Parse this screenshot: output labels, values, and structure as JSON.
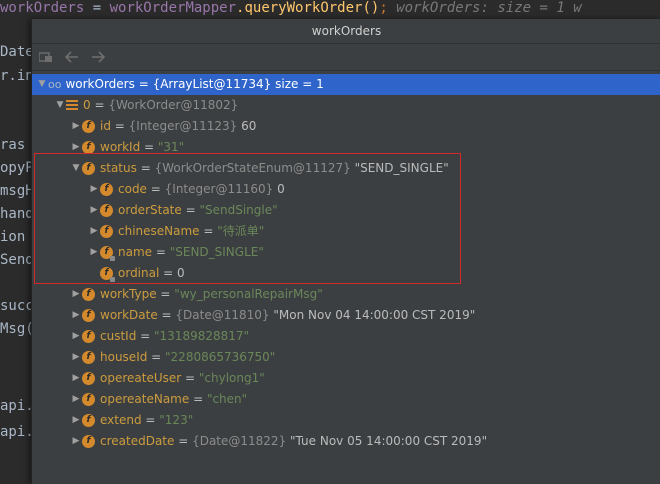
{
  "code_line": {
    "var": "workOrders",
    "assign": " = ",
    "receiver": "workOrderMapper",
    "call": ".queryWorkOrder()",
    "semi": ";",
    "hint": "  workOrders:  size = 1  w"
  },
  "left_code": [
    "Date",
    "r.in",
    "",
    "ras",
    "opyP",
    "msgH",
    "hand",
    "ion",
    "Send",
    "",
    "succ",
    "Msg(",
    "",
    "",
    "api.",
    "api."
  ],
  "window": {
    "title": "workOrders"
  },
  "toolbar": {
    "icons": [
      "watch-icon",
      "back-arrow-icon",
      "forward-arrow-icon"
    ]
  },
  "tree": {
    "root": {
      "name": "workOrders",
      "value": "{ArrayList@11734}  size = 1"
    },
    "item0": {
      "name": "0",
      "value": "{WorkOrder@11802}"
    },
    "id": {
      "name": "id",
      "type": "{Integer@11123}",
      "value": "60"
    },
    "workId": {
      "name": "workId",
      "value": "\"31\""
    },
    "status": {
      "name": "status",
      "type": "{WorkOrderStateEnum@11127}",
      "value": "\"SEND_SINGLE\""
    },
    "code": {
      "name": "code",
      "type": "{Integer@11160}",
      "value": "0"
    },
    "orderState": {
      "name": "orderState",
      "value": "\"SendSingle\""
    },
    "chineseName": {
      "name": "chineseName",
      "value": "\"待派单\""
    },
    "enumName": {
      "name": "name",
      "value": "\"SEND_SINGLE\""
    },
    "ordinal": {
      "name": "ordinal",
      "value": "0"
    },
    "workType": {
      "name": "workType",
      "value": "\"wy_personalRepairMsg\""
    },
    "workDate": {
      "name": "workDate",
      "type": "{Date@11810}",
      "value": "\"Mon Nov 04 14:00:00 CST 2019\""
    },
    "custId": {
      "name": "custId",
      "value": "\"13189828817\""
    },
    "houseId": {
      "name": "houseId",
      "value": "\"2280865736750\""
    },
    "opereateUser": {
      "name": "opereateUser",
      "value": "\"chylong1\""
    },
    "opereateName": {
      "name": "opereateName",
      "value": "\"chen\""
    },
    "extend": {
      "name": "extend",
      "value": "\"123\""
    },
    "createdDate": {
      "name": "createdDate",
      "type": "{Date@11822}",
      "value": "\"Tue Nov 05 14:00:00 CST 2019\""
    }
  },
  "colors": {
    "selection": "#2f65ca",
    "highlight_border": "#d22a2a",
    "field_icon": "#d48a2c",
    "string": "#6a8759"
  }
}
